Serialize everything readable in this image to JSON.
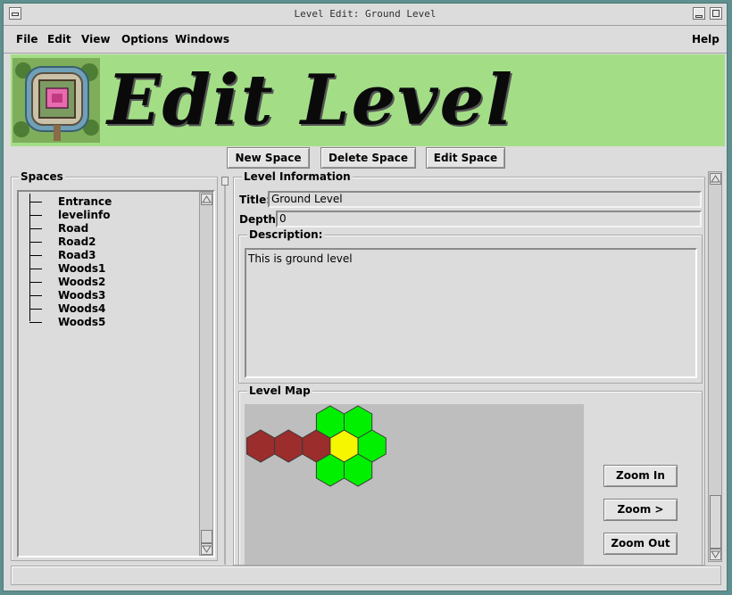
{
  "window": {
    "title": "Level Edit: Ground Level"
  },
  "menu": {
    "file": "File",
    "edit": "Edit",
    "view": "View",
    "options": "Options",
    "windows": "Windows",
    "help": "Help"
  },
  "banner": {
    "text": "Edit Level"
  },
  "toolbar": {
    "new_space": "New Space",
    "delete_space": "Delete Space",
    "edit_space": "Edit Space"
  },
  "spaces": {
    "label": "Spaces",
    "items": [
      "Entrance",
      "levelinfo",
      "Road",
      "Road2",
      "Road3",
      "Woods1",
      "Woods2",
      "Woods3",
      "Woods4",
      "Woods5"
    ]
  },
  "level_info": {
    "label": "Level Information",
    "title_label": "Title:",
    "title_value": "Ground Level",
    "depth_label": "Depth:",
    "depth_value": "0",
    "description_label": "Description:",
    "description_value": "This is ground level"
  },
  "level_map": {
    "label": "Level Map",
    "zoom_in": "Zoom In",
    "zoom_more": "Zoom >",
    "zoom_out": "Zoom Out",
    "colors": {
      "road": "#9b2d2d",
      "woods": "#00f000",
      "selected": "#f6f600",
      "canvas": "#bebebe"
    }
  }
}
